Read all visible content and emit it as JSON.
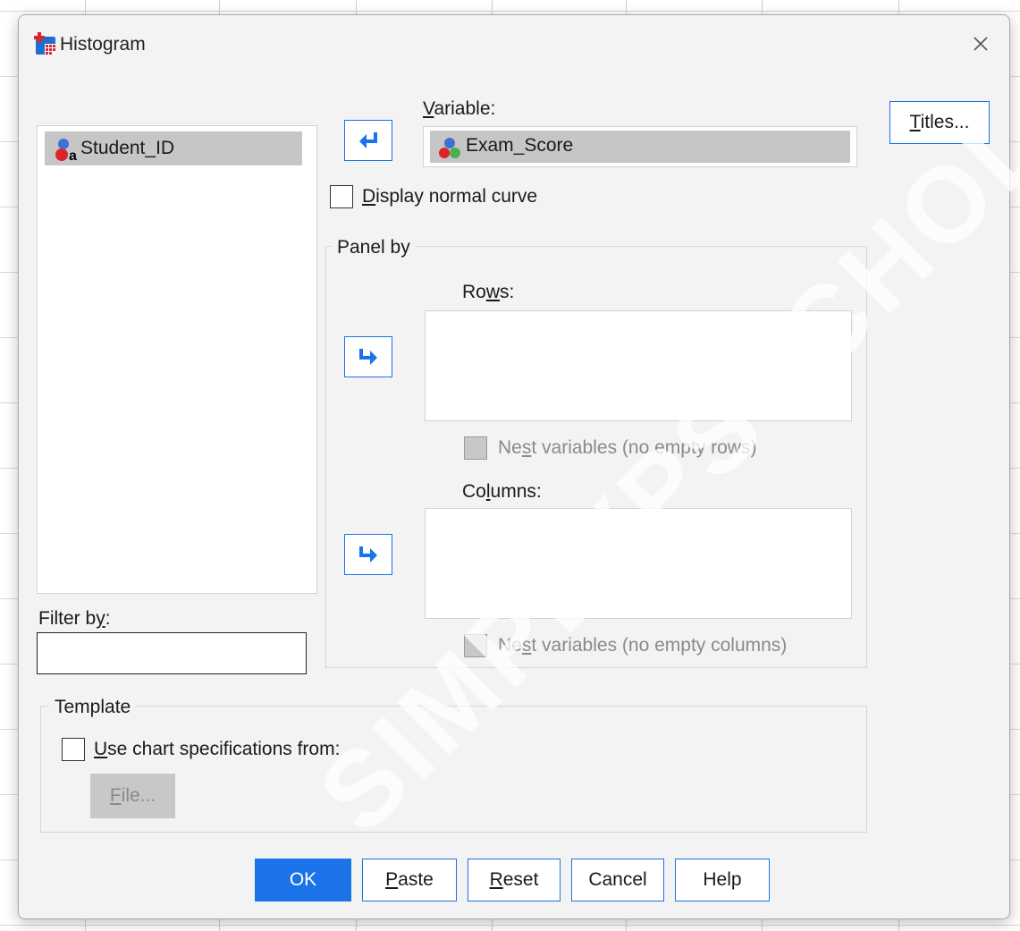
{
  "window": {
    "title": "Histogram",
    "close_icon": "close-icon"
  },
  "source_list": {
    "items": [
      {
        "label": "Student_ID",
        "icon": "nominal-string-variable-icon"
      }
    ]
  },
  "filter": {
    "label": "Filter by:",
    "value": ""
  },
  "variable": {
    "label": "Variable:",
    "value": "Exam_Score",
    "icon": "scale-variable-icon",
    "move_icon": "arrow-left-icon"
  },
  "normal_curve": {
    "label": "Display normal curve",
    "checked": false
  },
  "panel_by": {
    "title": "Panel by",
    "rows": {
      "label": "Rows:",
      "nest_label": "Nest variables (no empty rows)",
      "move_icon": "arrow-right-icon"
    },
    "columns": {
      "label": "Columns:",
      "nest_label": "Nest variables (no empty columns)",
      "move_icon": "arrow-right-icon"
    }
  },
  "template": {
    "title": "Template",
    "use_spec_label": "Use chart specifications from:",
    "file_button": "File...",
    "checked": false
  },
  "titles_button": "Titles...",
  "buttons": {
    "ok": "OK",
    "paste": "Paste",
    "reset": "Reset",
    "cancel": "Cancel",
    "help": "Help"
  },
  "colors": {
    "accent": "#1a73e8",
    "selection": "#c6c6c6",
    "dialog_bg": "#f3f3f3"
  },
  "watermark": "SIMPLYPSYCHOLOGY.COM"
}
